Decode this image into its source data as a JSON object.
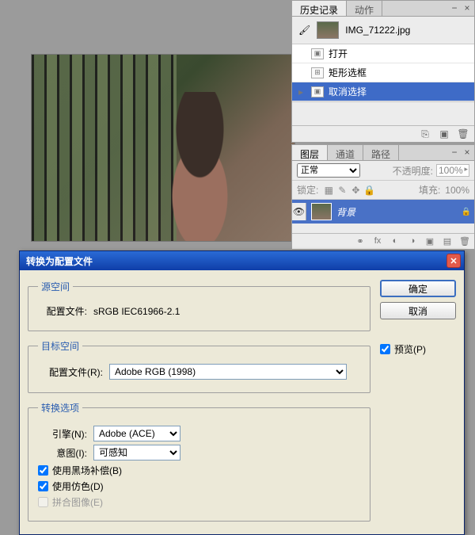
{
  "history_panel": {
    "tabs": {
      "history": "历史记录",
      "actions": "动作"
    },
    "file": "IMG_71222.jpg",
    "items": [
      {
        "icon": "▣",
        "label": "打开"
      },
      {
        "icon": "⊞",
        "label": "矩形选框"
      },
      {
        "icon": "▣",
        "label": "取消选择"
      }
    ]
  },
  "layers_panel": {
    "tabs": {
      "layers": "图层",
      "channels": "通道",
      "paths": "路径"
    },
    "blend_label": "正常",
    "opacity_label": "不透明度:",
    "opacity_value": "100%",
    "lock_label": "锁定:",
    "fill_label": "填充:",
    "fill_value": "100%",
    "layer_name": "背景"
  },
  "dialog": {
    "title": "转换为配置文件",
    "source_group": "源空间",
    "source_label": "配置文件:",
    "source_value": "sRGB IEC61966-2.1",
    "dest_group": "目标空间",
    "dest_label": "配置文件(R):",
    "dest_value": "Adobe RGB (1998)",
    "opts_group": "转换选项",
    "engine_label": "引擎(N):",
    "engine_value": "Adobe (ACE)",
    "intent_label": "意图(I):",
    "intent_value": "可感知",
    "bpc": "使用黑场补偿(B)",
    "dither": "使用仿色(D)",
    "flatten": "拼合图像(E)",
    "ok": "确定",
    "cancel": "取消",
    "preview": "预览(P)"
  }
}
